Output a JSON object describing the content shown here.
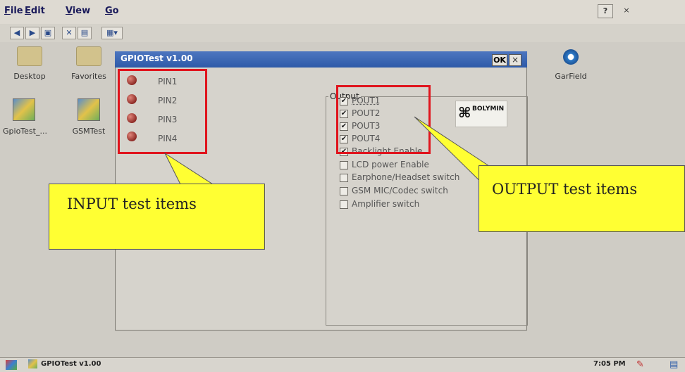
{
  "menubar": {
    "items": [
      "File",
      "Edit",
      "View",
      "Go"
    ],
    "help_label": "?",
    "close_label": "×"
  },
  "desktop": {
    "icons": [
      "Desktop",
      "Favorites",
      "GpioTest_...",
      "GSMTest"
    ],
    "right_icon": "GarField"
  },
  "dialog": {
    "title": "GPIOTest v1.00",
    "ok_label": "OK",
    "close_label": "×",
    "pins": [
      "PIN1",
      "PIN2",
      "PIN3",
      "PIN4"
    ],
    "output_legend": "Output",
    "outputs": [
      {
        "label": "POUT1",
        "checked": true
      },
      {
        "label": "POUT2",
        "checked": true
      },
      {
        "label": "POUT3",
        "checked": true
      },
      {
        "label": "POUT4",
        "checked": true
      },
      {
        "label": "Backlight Enable",
        "checked": true
      },
      {
        "label": "LCD power Enable",
        "checked": false
      },
      {
        "label": "Earphone/Headset switch",
        "checked": false
      },
      {
        "label": "GSM MIC/Codec switch",
        "checked": false
      },
      {
        "label": "Amplifier switch",
        "checked": false
      }
    ],
    "logo_text": "BOLYMIN"
  },
  "callouts": {
    "input": "INPUT test items",
    "output": "OUTPUT test items"
  },
  "taskbar": {
    "item_label": "GPIOTest v1.00",
    "clock": "7:05 PM"
  },
  "colors": {
    "highlight": "#e0141d",
    "callout": "#ffff33",
    "titlebar": "#2e5aa8"
  }
}
